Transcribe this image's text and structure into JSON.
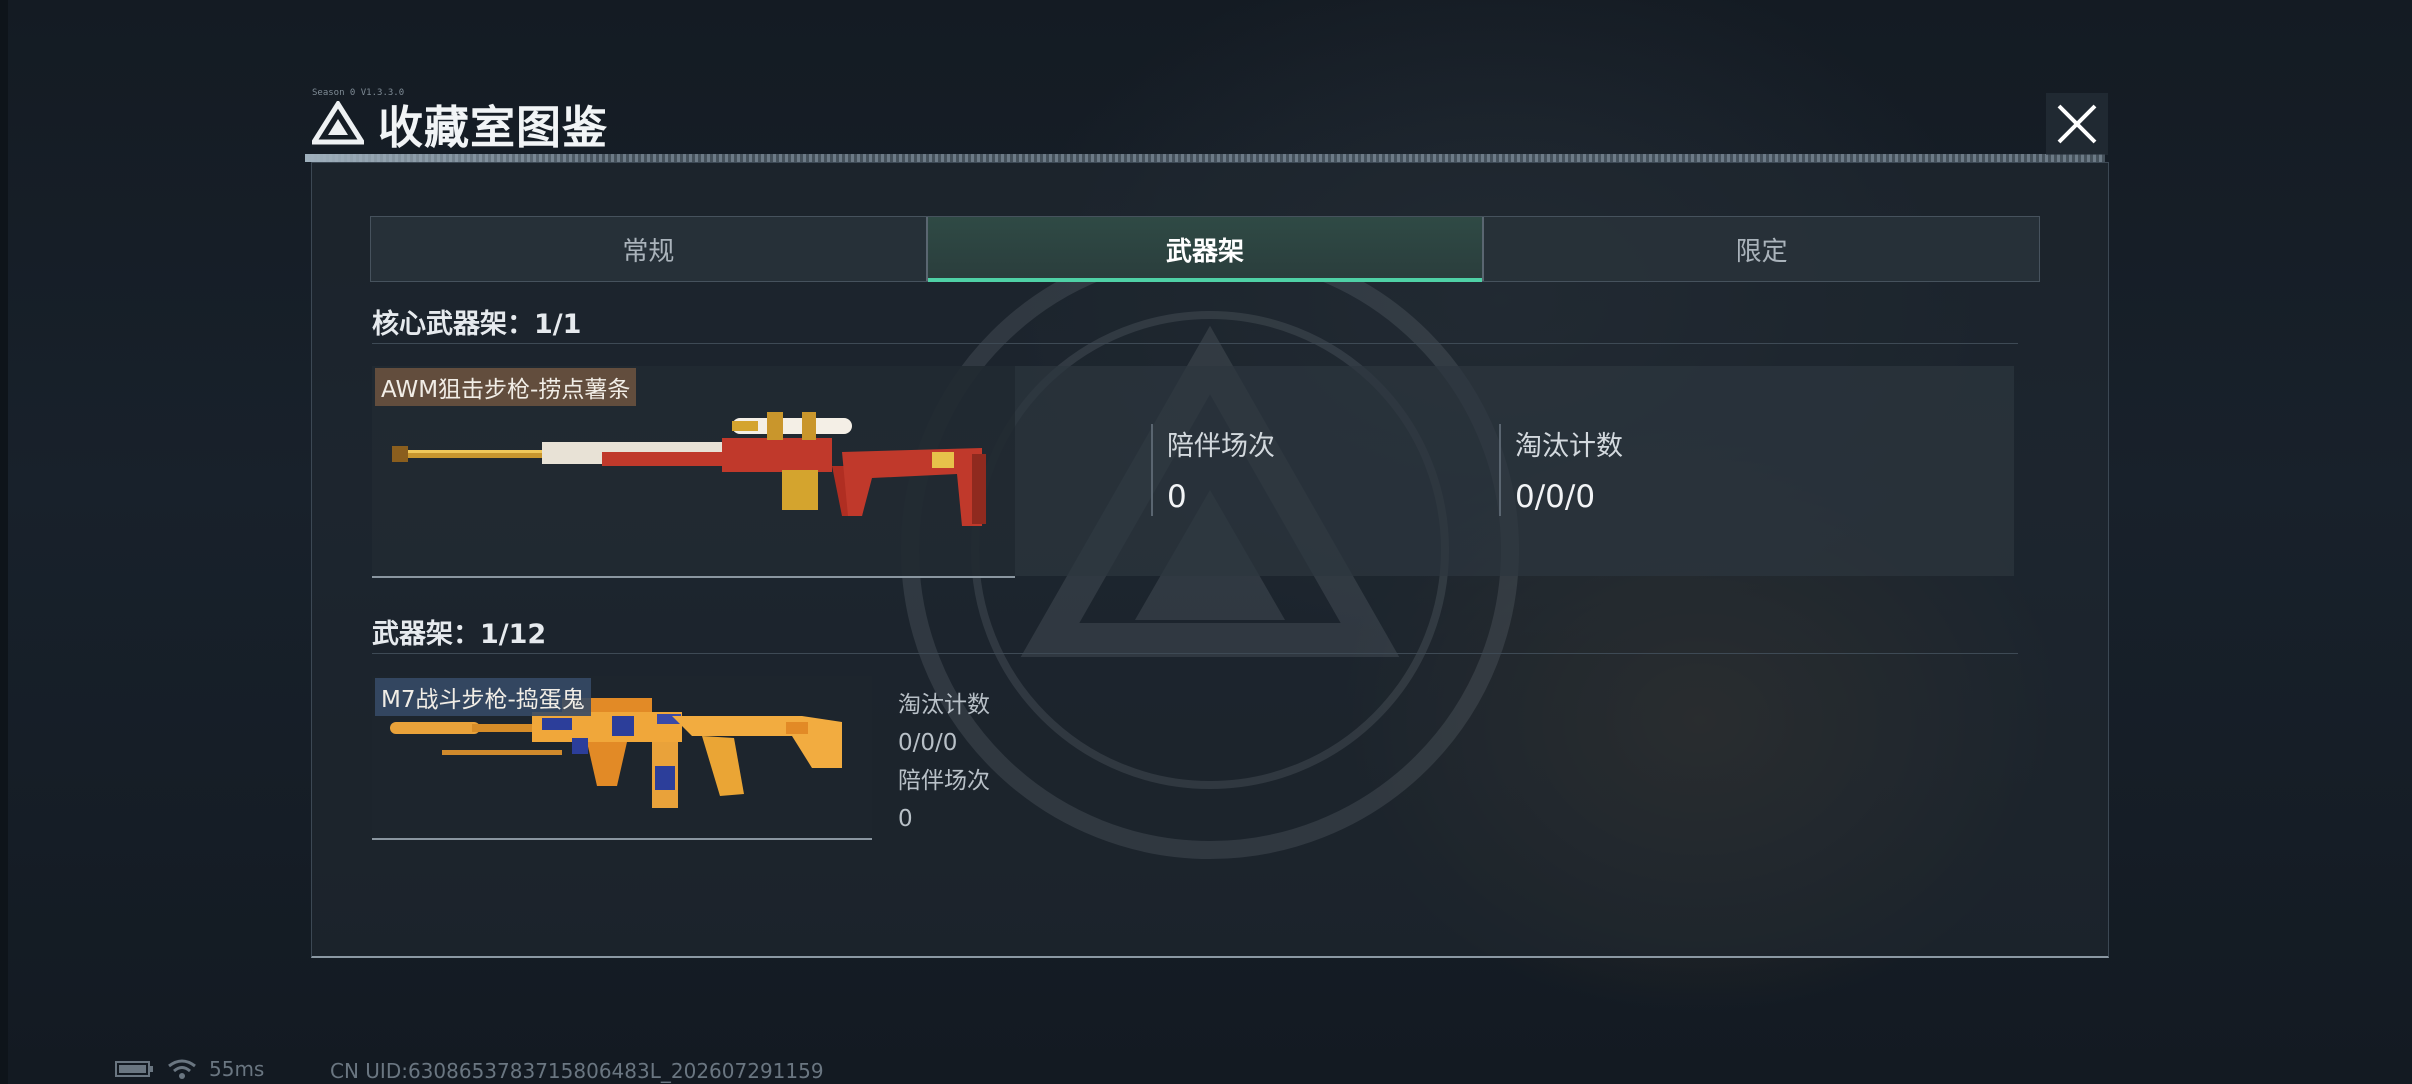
{
  "header": {
    "title": "收藏室图鉴",
    "code": "Season 0 V1.3.3.0"
  },
  "tabs": [
    {
      "label": "常规",
      "active": false
    },
    {
      "label": "武器架",
      "active": true
    },
    {
      "label": "限定",
      "active": false
    }
  ],
  "core_section": {
    "title": "核心武器架：1/1",
    "item": {
      "name": "AWM狙击步枪-捞点薯条",
      "stat1_label": "陪伴场次",
      "stat1_value": "0",
      "stat2_label": "淘汰计数",
      "stat2_value": "0/0/0"
    }
  },
  "rack_section": {
    "title": "武器架：1/12",
    "item": {
      "name": "M7战斗步枪-捣蛋鬼",
      "stat1_label": "淘汰计数",
      "stat1_value": "0/0/0",
      "stat2_label": "陪伴场次",
      "stat2_value": "0"
    }
  },
  "status_bar": {
    "ping": "55ms",
    "uid": "CN UID:6308653783715806483L_202607291159"
  },
  "colors": {
    "accent": "#4fd1a6",
    "panel": "#202830",
    "text": "#d7dde3"
  }
}
